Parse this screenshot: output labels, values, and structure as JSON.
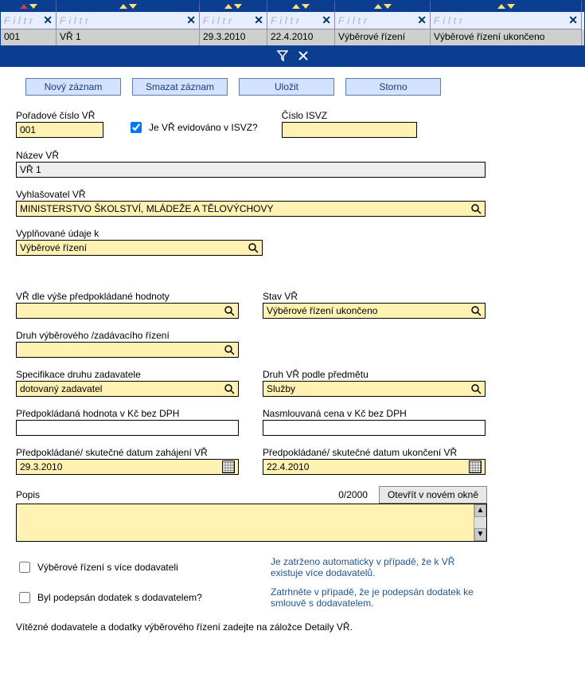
{
  "grid": {
    "columns_widths": [
      70,
      180,
      85,
      85,
      120,
      190
    ],
    "filter_placeholder": "Filtr",
    "data_row": [
      "001",
      "VŘ 1",
      "29.3.2010",
      "22.4.2010",
      "Výběrové řízení",
      "Výběrové řízení ukončeno"
    ]
  },
  "buttons": {
    "new": "Nový záznam",
    "delete": "Smazat záznam",
    "save": "Uložit",
    "cancel": "Storno"
  },
  "form": {
    "seq_label": "Pořadové číslo VŘ",
    "seq_value": "001",
    "isvz_checkbox_label": "Je VŘ evidováno v ISVZ?",
    "isvz_checked": true,
    "isvz_num_label": "Číslo ISVZ",
    "isvz_num_value": "",
    "name_label": "Název VŘ",
    "name_value": "VŘ 1",
    "declarant_label": "Vyhlašovatel VŘ",
    "declarant_value": "MINISTERSTVO ŠKOLSTVÍ, MLÁDEŽE A TĚLOVÝCHOVY",
    "filled_data_label": "Vyplňované údaje k",
    "filled_data_value": "Výběrové řízení",
    "by_value_label": "VŘ dle výše předpokládané hodnoty",
    "by_value_value": "",
    "state_label": "Stav VŘ",
    "state_value": "Výběrové řízení ukončeno",
    "kind_label": "Druh výběrového /zadávacího řízení",
    "kind_value": "",
    "spec_label": "Specifikace druhu zadavatele",
    "spec_value": "dotovaný zadavatel",
    "subject_kind_label": "Druh VŘ podle předmětu",
    "subject_kind_value": "Služby",
    "expected_price_label": "Předpokládaná hodnota v Kč bez DPH",
    "expected_price_value": "",
    "contracted_price_label": "Nasmlouvaná cena v Kč bez DPH",
    "contracted_price_value": "",
    "start_date_label": "Předpokládané/ skutečné datum zahájení VŘ",
    "start_date_value": "29.3.2010",
    "end_date_label": "Předpokládané/ skutečné datum ukončení VŘ",
    "end_date_value": "22.4.2010",
    "desc_label": "Popis",
    "desc_counter": "0/2000",
    "open_window_btn": "Otevřít v novém okně",
    "multi_suppliers_label": "Výběrové řízení s více dodavateli",
    "multi_suppliers_help": "Je zatrženo automaticky v případě, že k VŘ existuje více dodavatelů.",
    "amendment_label": "Byl podepsán dodatek s dodavatelem?",
    "amendment_help": "Zatrhněte v případě, že je podepsán dodatek ke smlouvě s dodavatelem.",
    "footer_note": "Vítězné dodavatele a dodatky výběrového řízení zadejte na záložce Detaily VŘ."
  }
}
